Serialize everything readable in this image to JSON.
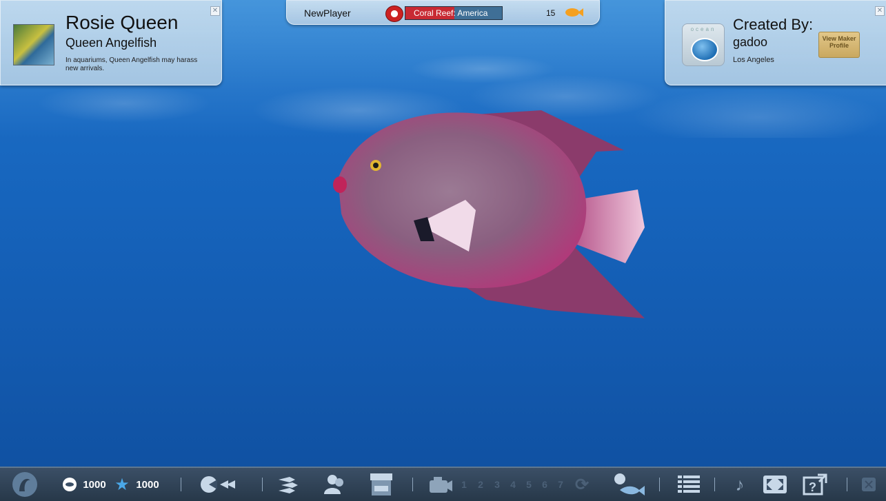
{
  "info_panel": {
    "fish_name": "Rosie Queen",
    "species": "Queen Angelfish",
    "fact": "In aquariums, Queen Angelfish may harass new arrivals."
  },
  "top_bar": {
    "player": "NewPlayer",
    "tank": "Coral Reef: America",
    "tank_fill": 0.51,
    "fish_count": "15"
  },
  "maker_panel": {
    "logo_text": "ocean",
    "created_label": "Created By:",
    "maker": "gadoo",
    "location": "Los Angeles",
    "profile_button": "View Maker Profile"
  },
  "bottom_bar": {
    "coins": "1000",
    "stars": "1000",
    "slots": [
      "1",
      "2",
      "3",
      "4",
      "5",
      "6",
      "7"
    ]
  },
  "colors": {
    "accent_red": "#c82a33",
    "bar_bg": "#273849",
    "star": "#4aa8e8"
  }
}
